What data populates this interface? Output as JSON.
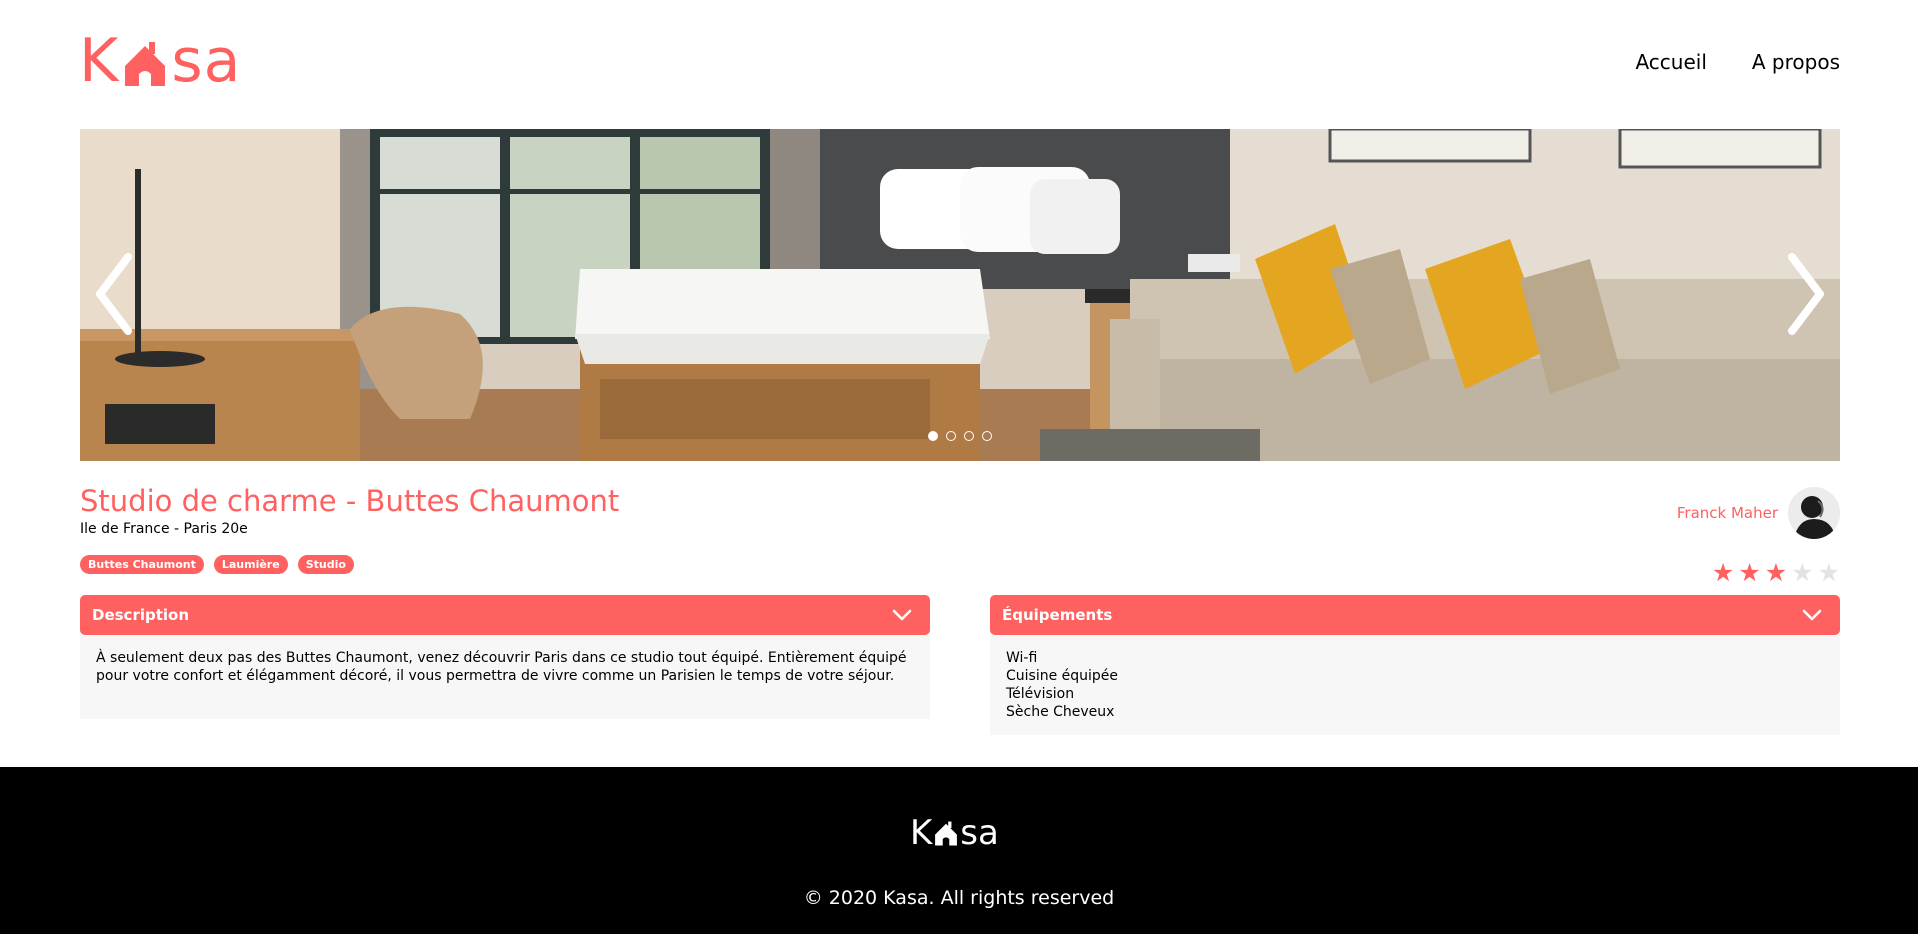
{
  "header": {
    "logo": {
      "prefix": "K",
      "suffix": "sa",
      "color": "#FF6060"
    },
    "nav": [
      {
        "label": "Accueil"
      },
      {
        "label": "A propos"
      }
    ]
  },
  "carousel": {
    "slide_count": 4,
    "active_index": 0,
    "prev_icon": "chevron-left-icon",
    "next_icon": "chevron-right-icon"
  },
  "listing": {
    "title": "Studio de charme - Buttes Chaumont",
    "location": "Ile de France - Paris 20e",
    "tags": [
      {
        "label": "Buttes Chaumont"
      },
      {
        "label": "Laumière"
      },
      {
        "label": "Studio"
      }
    ],
    "host": {
      "name": "Franck Maher"
    },
    "rating": {
      "value": 3,
      "max": 5,
      "filled_color": "#FF6060",
      "empty_color": "#E3E3E3"
    }
  },
  "description": {
    "label": "Description",
    "text": "À seulement deux pas des Buttes Chaumont, venez découvrir Paris dans ce studio tout équipé. Entièrement équipé pour votre confort et élégamment décoré, il vous permettra de vivre comme un Parisien le temps de votre séjour."
  },
  "equipments": {
    "label": "Équipements",
    "items": [
      "Wi-fi",
      "Cuisine équipée",
      "Télévision",
      "Sèche Cheveux"
    ]
  },
  "footer": {
    "logo": {
      "prefix": "K",
      "suffix": "sa"
    },
    "copyright": "© 2020 Kasa. All rights reserved"
  }
}
